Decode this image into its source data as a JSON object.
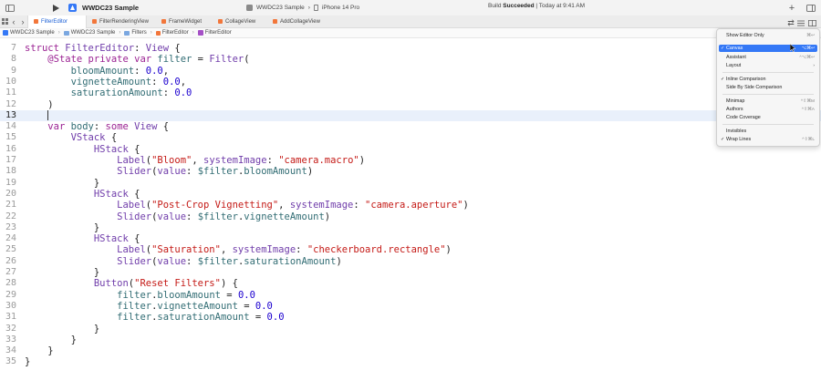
{
  "toolbar": {
    "project_title": "WWDC23 Sample",
    "scheme_target": "WWDC23 Sample",
    "scheme_separator": "›",
    "device": "iPhone 14 Pro",
    "status_prefix": "Build",
    "status_bold": "Succeeded",
    "status_suffix": "| Today at 9:41 AM",
    "icons": [
      "sidebar-toggle-icon",
      "run-icon",
      "add-icon",
      "inspector-toggle-icon"
    ]
  },
  "tabs": [
    {
      "label": "FilterEditor",
      "active": true
    },
    {
      "label": "FilterRenderingView",
      "active": false
    },
    {
      "label": "FrameWidget",
      "active": false
    },
    {
      "label": "CollageView",
      "active": false
    },
    {
      "label": "AddCollageView",
      "active": false
    }
  ],
  "breadcrumb": [
    "WWDC23 Sample",
    "WWDC23 Sample",
    "Filters",
    "FilterEditor",
    "FilterEditor"
  ],
  "code_lines": [
    {
      "n": "7"
    },
    {
      "n": "8"
    },
    {
      "n": "9"
    },
    {
      "n": "10"
    },
    {
      "n": "11"
    },
    {
      "n": "12"
    },
    {
      "n": "13"
    },
    {
      "n": "14"
    },
    {
      "n": "15"
    },
    {
      "n": "16"
    },
    {
      "n": "17"
    },
    {
      "n": "18"
    },
    {
      "n": "19"
    },
    {
      "n": "20"
    },
    {
      "n": "21"
    },
    {
      "n": "22"
    },
    {
      "n": "23"
    },
    {
      "n": "24"
    },
    {
      "n": "25"
    },
    {
      "n": "26"
    },
    {
      "n": "27"
    },
    {
      "n": "28"
    },
    {
      "n": "29"
    },
    {
      "n": "30"
    },
    {
      "n": "31"
    },
    {
      "n": "32"
    },
    {
      "n": "33"
    },
    {
      "n": "34"
    },
    {
      "n": "35"
    }
  ],
  "code": {
    "l7": [
      "struct ",
      "FilterEditor",
      ": ",
      "View",
      " {"
    ],
    "l8": [
      "    ",
      "@State private var ",
      "filter",
      " = ",
      "Filter",
      "("
    ],
    "l9": [
      "        ",
      "bloomAmount",
      ": ",
      "0.0",
      ","
    ],
    "l10": [
      "        ",
      "vignetteAmount",
      ": ",
      "0.0",
      ","
    ],
    "l11": [
      "        ",
      "saturationAmount",
      ": ",
      "0.0"
    ],
    "l12": [
      "    )"
    ],
    "l14": [
      "    ",
      "var ",
      "body",
      ": ",
      "some ",
      "View",
      " {"
    ],
    "l15": [
      "        ",
      "VStack",
      " {"
    ],
    "l16": [
      "            ",
      "HStack",
      " {"
    ],
    "l17": [
      "                ",
      "Label",
      "(",
      "\"Bloom\"",
      ", ",
      "systemImage",
      ": ",
      "\"camera.macro\"",
      ")"
    ],
    "l18": [
      "                ",
      "Slider",
      "(",
      "value",
      ": ",
      "$filter",
      ".",
      "bloomAmount",
      ")"
    ],
    "l19": [
      "            }"
    ],
    "l20": [
      "            ",
      "HStack",
      " {"
    ],
    "l21": [
      "                ",
      "Label",
      "(",
      "\"Post-Crop Vignetting\"",
      ", ",
      "systemImage",
      ": ",
      "\"camera.aperture\"",
      ")"
    ],
    "l22": [
      "                ",
      "Slider",
      "(",
      "value",
      ": ",
      "$filter",
      ".",
      "vignetteAmount",
      ")"
    ],
    "l23": [
      "            }"
    ],
    "l24": [
      "            ",
      "HStack",
      " {"
    ],
    "l25": [
      "                ",
      "Label",
      "(",
      "\"Saturation\"",
      ", ",
      "systemImage",
      ": ",
      "\"checkerboard.rectangle\"",
      ")"
    ],
    "l26": [
      "                ",
      "Slider",
      "(",
      "value",
      ": ",
      "$filter",
      ".",
      "saturationAmount",
      ")"
    ],
    "l27": [
      "            }"
    ],
    "l28": [
      "            ",
      "Button",
      "(",
      "\"Reset Filters\"",
      ") {"
    ],
    "l29": [
      "                ",
      "filter",
      ".",
      "bloomAmount",
      " = ",
      "0.0"
    ],
    "l30": [
      "                ",
      "filter",
      ".",
      "vignetteAmount",
      " = ",
      "0.0"
    ],
    "l31": [
      "                ",
      "filter",
      ".",
      "saturationAmount",
      " = ",
      "0.0"
    ],
    "l32": [
      "            }"
    ],
    "l33": [
      "        }"
    ],
    "l34": [
      "    }"
    ],
    "l35": [
      "}"
    ]
  },
  "menu": {
    "items": [
      {
        "label": "Show Editor Only",
        "shortcut": "⌘↩",
        "checked": false
      },
      {
        "label": "Canvas",
        "shortcut": "⌥⌘↩",
        "checked": true,
        "highlighted": true
      },
      {
        "label": "Assistant",
        "shortcut": "^⌥⌘↩",
        "checked": false
      },
      {
        "label": "Layout",
        "shortcut": "›",
        "checked": false
      },
      {
        "label": "Inline Comparison",
        "shortcut": "",
        "checked": true
      },
      {
        "label": "Side By Side Comparison",
        "shortcut": "",
        "checked": false
      },
      {
        "label": "Minimap",
        "shortcut": "^⇧⌘M",
        "checked": false
      },
      {
        "label": "Authors",
        "shortcut": "^⇧⌘A",
        "checked": false
      },
      {
        "label": "Code Coverage",
        "shortcut": "",
        "checked": false
      },
      {
        "label": "Invisibles",
        "shortcut": "",
        "checked": false
      },
      {
        "label": "Wrap Lines",
        "shortcut": "^⇧⌘L",
        "checked": true
      }
    ],
    "check_mark": "✓"
  },
  "colors": {
    "keyword": "#9b2393",
    "type": "#703daa",
    "identifier": "#326d74",
    "string": "#c41a16",
    "number": "#1c00cf",
    "current_line": "#e9f0fb",
    "menu_highlight": "#3478f6"
  }
}
